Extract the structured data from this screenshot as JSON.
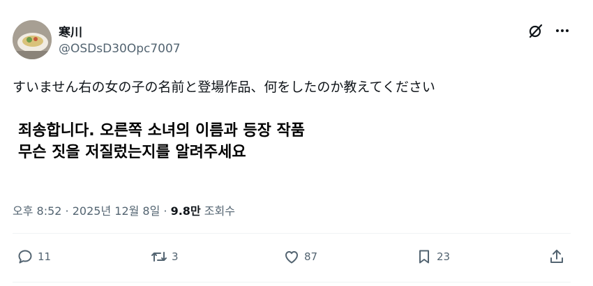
{
  "author": {
    "display_name": "寒川",
    "handle": "@OSDsD30Opc7007"
  },
  "post": {
    "text": "すいません右の女の子の名前と登場作品、何をしたのか教えてください"
  },
  "overlay_caption": {
    "line1": "죄송합니다. 오른쪽 소녀의 이름과 등장 작품",
    "line2": "무슨 짓을 저질렀는지를 알려주세요"
  },
  "meta": {
    "time": "오후 8:52",
    "separator1": " · ",
    "date": "2025년 12월 8일",
    "separator2": " · ",
    "views_count": "9.8만",
    "views_label": " 조회수"
  },
  "actions": {
    "replies": "11",
    "reposts": "3",
    "likes": "87",
    "bookmarks": "23"
  },
  "icons": {
    "grok": "grok-icon",
    "more": "more-icon",
    "reply": "reply-icon",
    "repost": "repost-icon",
    "like": "heart-icon",
    "bookmark": "bookmark-icon",
    "share": "share-icon"
  }
}
